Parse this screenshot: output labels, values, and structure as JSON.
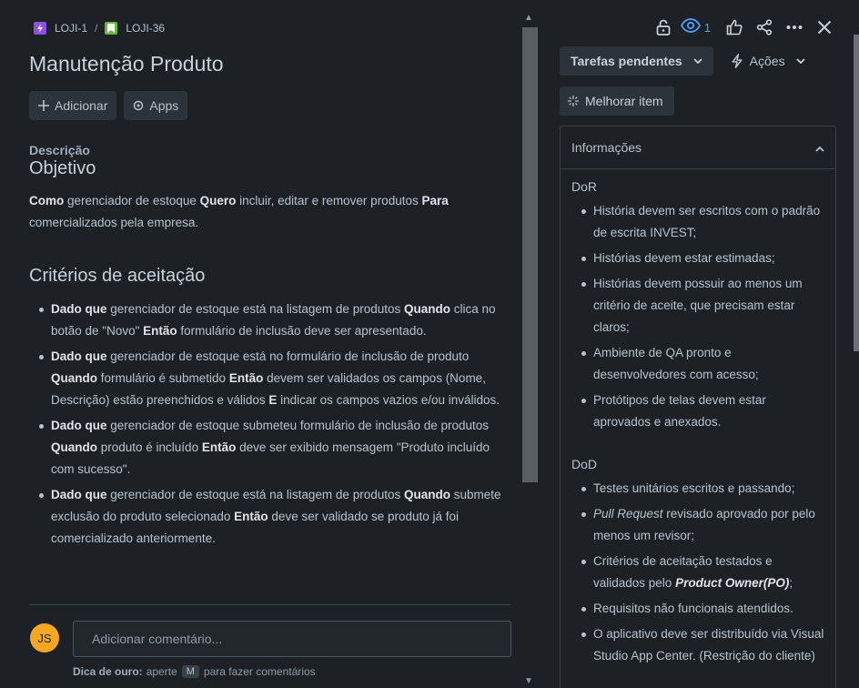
{
  "breadcrumb": {
    "parent_key": "LOJI-1",
    "separator": "/",
    "issue_key": "LOJI-36",
    "colors": {
      "epic": "#904ee2",
      "story": "#63ba3c"
    }
  },
  "issue": {
    "title": "Manutenção Produto"
  },
  "actions": {
    "add_label": "Adicionar",
    "apps_label": "Apps"
  },
  "description": {
    "label": "Descrição",
    "heading": "Objetivo",
    "para": {
      "k1": "Como",
      "t1": " gerenciador de estoque ",
      "k2": "Quero",
      "t2": " incluir, editar e remover produtos ",
      "k3": "Para",
      "t3": " comercializados pela empresa."
    },
    "criteria_heading": "Critérios de aceitação",
    "criteria": [
      {
        "k1": "Dado que",
        "t1": " gerenciador de estoque está na listagem de produtos ",
        "k2": "Quando",
        "t2": " clica no botão de \"Novo\" ",
        "k3": "Então",
        "t3": " formulário de inclusão deve ser apresentado."
      },
      {
        "k1": "Dado que",
        "t1": " gerenciador de estoque está no formulário de inclusão de produto ",
        "k2": "Quando",
        "t2": " formulário é submetido ",
        "k3": "Então",
        "t3": " devem ser validados os campos (Nome, Descrição) estão preenchidos e válidos ",
        "k4": "E",
        "t4": " indicar os campos vazios e/ou inválidos."
      },
      {
        "k1": "Dado que",
        "t1": " gerenciador de estoque submeteu formulário de inclusão de produtos ",
        "k2": "Quando",
        "t2": " produto é incluído ",
        "k3": "Então",
        "t3": " deve ser exibido mensagem \"Produto incluído com sucesso\"."
      },
      {
        "k1": "Dado que",
        "t1": " gerenciador de estoque está na listagem de produtos ",
        "k2": "Quando",
        "t2": " submete exclusão do produto selecionado ",
        "k3": "Então",
        "t3": " deve ser validado se produto já foi comercializado anteriormente."
      }
    ]
  },
  "comment": {
    "avatar_initials": "JS",
    "avatar_color": "#f5a623",
    "placeholder": "Adicionar comentário...",
    "tip_bold": "Dica de ouro:",
    "tip_pre": "aperte",
    "tip_key": "M",
    "tip_post": "para fazer comentários"
  },
  "toolbar": {
    "watchers_count": "1",
    "icons": [
      "unlock-icon",
      "eye-icon",
      "thumbs-up-icon",
      "share-icon",
      "more-icon",
      "close-icon"
    ],
    "accent": "#579dff"
  },
  "status": {
    "label": "Tarefas pendentes"
  },
  "acoes": {
    "label": "Ações"
  },
  "improve": {
    "label": "Melhorar item"
  },
  "info_panel": {
    "title": "Informações",
    "dor_label": "DoR",
    "dor_items": [
      {
        "text": "História devem ser escritos com o padrão de escrita INVEST;"
      },
      {
        "text": "Histórias devem estar estimadas;"
      },
      {
        "text": "Histórias devem possuir ao menos um critério de aceite, que precisam estar claros;"
      },
      {
        "text": "Ambiente de QA pronto e desenvolvedores com acesso;"
      },
      {
        "text": "Protótipos de telas devem estar aprovados e anexados."
      }
    ],
    "dod_label": "DoD",
    "dod_items": [
      {
        "text": "Testes unitários escritos e passando;"
      },
      {
        "italic": "Pull Request",
        "text": " revisado aprovado por pelo menos um revisor;"
      },
      {
        "text": "Critérios de aceitação testados e validados pelo ",
        "bold_italic": "Product Owner(PO)",
        "text_after": ";"
      },
      {
        "text": "Requisitos não funcionais atendidos."
      },
      {
        "text": "O aplicativo deve ser distribuído via Visual Studio App Center. (Restrição do cliente)"
      }
    ]
  }
}
